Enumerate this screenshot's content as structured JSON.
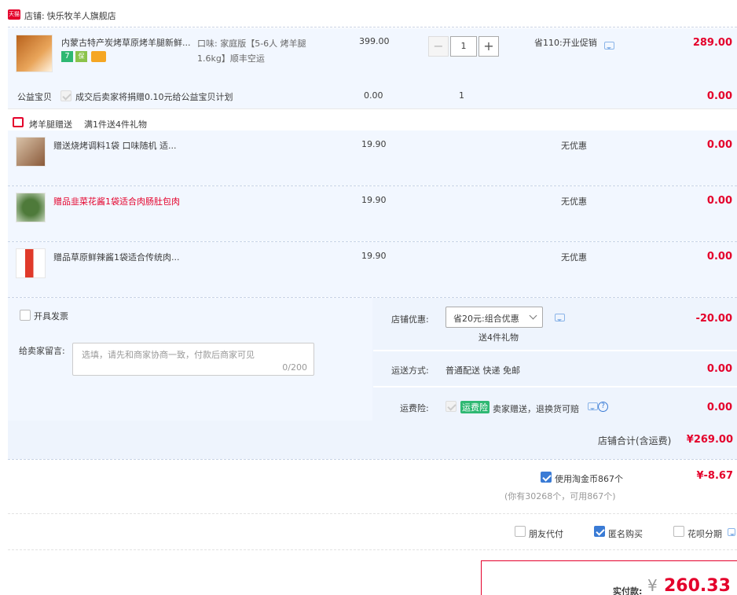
{
  "shop": {
    "badge": "天猫",
    "label": "店铺:",
    "name": "快乐牧羊人旗舰店"
  },
  "item": {
    "title": "内蒙古特产炭烤草原烤羊腿新鲜...",
    "spec": "口味: 家庭版【5-6人 烤羊腿1.6kg】顺丰空运",
    "price": "399.00",
    "qty": "1",
    "promo": "省110:开业促销",
    "subtotal": "289.00",
    "badges": [
      "7",
      "保"
    ]
  },
  "charity": {
    "label": "公益宝贝",
    "text": "成交后卖家将捐赠0.10元给公益宝贝计划",
    "price": "0.00",
    "qty": "1",
    "subtotal": "0.00"
  },
  "gift_header": {
    "title": "烤羊腿赠送",
    "rule": "满1件送4件礼物"
  },
  "gifts": [
    {
      "title": "赠送烧烤调料1袋 口味随机 适...",
      "price": "19.90",
      "promo": "无优惠",
      "subtotal": "0.00"
    },
    {
      "title": "赠品韭菜花酱1袋适合肉肠肚包肉",
      "price": "19.90",
      "promo": "无优惠",
      "subtotal": "0.00"
    },
    {
      "title": "赠品草原鲜辣酱1袋适合传统肉...",
      "price": "19.90",
      "promo": "无优惠",
      "subtotal": "0.00"
    }
  ],
  "invoice": {
    "label": "开具发票"
  },
  "message": {
    "label": "给卖家留言:",
    "placeholder": "选填，请先和商家协商一致，付款后商家可见",
    "counter": "0/200"
  },
  "shop_discount": {
    "label": "店铺优惠:",
    "selected": "省20元:组合优惠",
    "note": "送4件礼物",
    "amount": "-20.00"
  },
  "shipping": {
    "label": "运送方式:",
    "value": "普通配送 快递 免邮",
    "amount": "0.00"
  },
  "insurance": {
    "label": "运费险:",
    "tag": "运费险",
    "text": "卖家赠送，退换货可赔",
    "amount": "0.00"
  },
  "shop_total": {
    "label": "店铺合计(含运费)",
    "amount": "¥269.00"
  },
  "coins": {
    "label": "使用淘金币867个",
    "detail": "(你有30268个，可用867个)",
    "amount": "¥-8.67"
  },
  "options": {
    "friend_pay": "朋友代付",
    "anonymous": "匿名购买",
    "huabei": "花呗分期"
  },
  "pay": {
    "label": "实付款:",
    "currency": "¥",
    "amount": "260.33"
  },
  "colors": {
    "accent": "#e4002b",
    "blue": "#3a7bd5",
    "row_bg": "#f2f7ff"
  }
}
